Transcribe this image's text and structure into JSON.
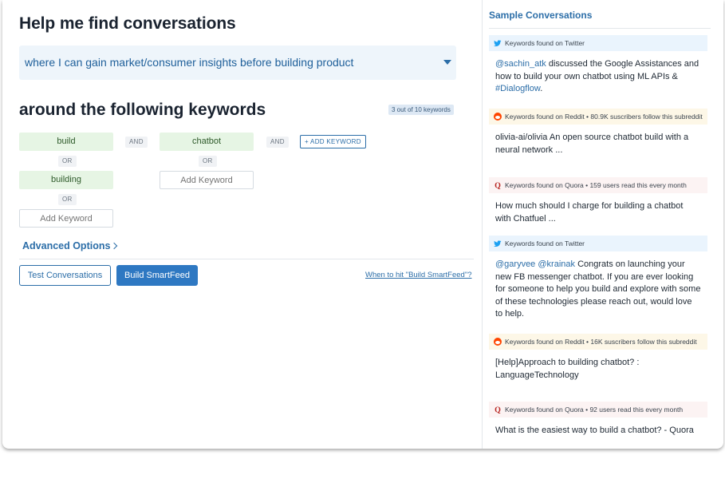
{
  "main": {
    "title": "Help me find conversations",
    "intent": "where I can gain market/consumer insights before building product",
    "keywords_title": "around the following keywords",
    "keyword_count": "3 out of 10 keywords",
    "columns": [
      {
        "keywords": [
          "build",
          "building"
        ],
        "or_label": "OR",
        "placeholder": "Add Keyword"
      },
      {
        "keywords": [
          "chatbot"
        ],
        "or_label": "OR",
        "placeholder": "Add Keyword"
      }
    ],
    "and_label": "AND",
    "add_keyword_button": "+ ADD KEYWORD",
    "advanced_options": "Advanced Options",
    "test_button": "Test Conversations",
    "build_button": "Build SmartFeed",
    "help_link": "When to hit \"Build SmartFeed\"?"
  },
  "sidebar": {
    "title": "Sample Conversations",
    "items": [
      {
        "source": "twitter",
        "header": "Keywords found on Twitter",
        "body": [
          {
            "t": "@sachin_atk",
            "hl": true
          },
          {
            "t": " discussed the Google Assistances and how to build your own chatbot using ML APIs & ",
            "hl": false
          },
          {
            "t": "#Dialogflow",
            "hl": true
          },
          {
            "t": ".",
            "hl": false
          }
        ]
      },
      {
        "source": "reddit",
        "header": "Keywords found on Reddit • 80.9K suscribers follow this subreddit",
        "body": [
          {
            "t": "olivia-ai/olivia An open source chatbot build with a neural network ...",
            "hl": false
          }
        ]
      },
      {
        "source": "quora",
        "header": "Keywords found on Quora • 159 users read this every month",
        "body": [
          {
            "t": "How much should I charge for building a chatbot with Chatfuel ...",
            "hl": false
          }
        ]
      },
      {
        "source": "twitter",
        "header": "Keywords found on Twitter",
        "body": [
          {
            "t": "@garyvee",
            "hl": true
          },
          {
            "t": " ",
            "hl": false
          },
          {
            "t": "@krainak",
            "hl": true
          },
          {
            "t": " Congrats on launching your new FB messenger chatbot. If you are ever looking for someone to help you build and explore with some of these technologies please reach out, would love to help.",
            "hl": false
          }
        ]
      },
      {
        "source": "reddit",
        "header": "Keywords found on Reddit • 16K suscribers follow this subreddit",
        "body": [
          {
            "t": "[Help]Approach to building chatbot? : LanguageTechnology",
            "hl": false
          }
        ]
      },
      {
        "source": "quora",
        "header": "Keywords found on Quora • 92 users read this every month",
        "body": [
          {
            "t": "What is the easiest way to build a chatbot? - Quora",
            "hl": false
          }
        ]
      }
    ]
  },
  "colors": {
    "accent": "#2c6ea8",
    "primary_button": "#2e78c2",
    "keyword_bg": "#e6f5e4",
    "twitter": "#1da1f2",
    "reddit": "#ff4500",
    "quora": "#b92b27"
  }
}
